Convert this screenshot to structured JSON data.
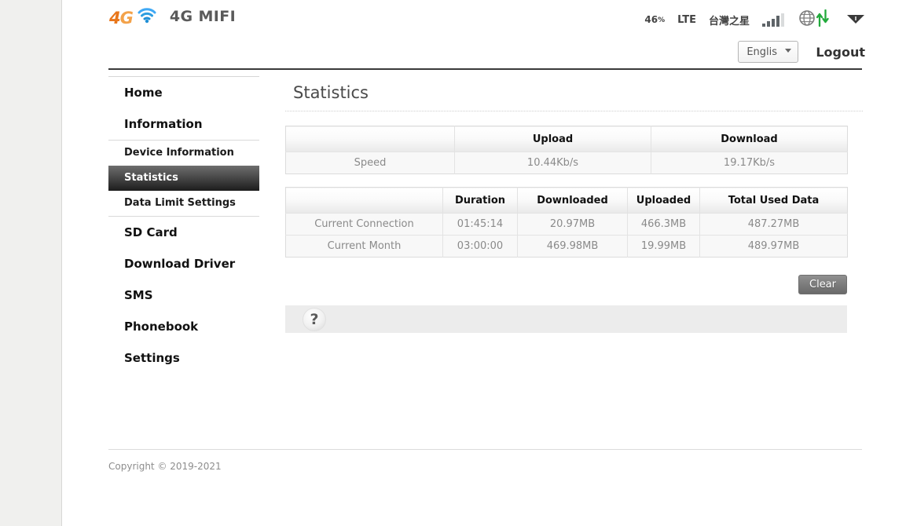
{
  "header": {
    "logo_text_4": "4",
    "logo_text_g": "G",
    "wifi_icon": "wifi-icon",
    "brand_title": "4G MIFI",
    "status": {
      "battery_percent": "46",
      "battery_unit": "%",
      "network_type": "LTE",
      "carrier": "台灣之星",
      "signal_icon": "signal-bars-icon",
      "signal_bars_active": 4,
      "signal_bars_total": 5,
      "globe_icon": "globe-icon",
      "transfer_icon": "upload-download-arrows-icon",
      "wifi_status_icon": "wifi-signal-icon"
    },
    "language": {
      "selected": "English",
      "options": [
        "English"
      ],
      "chevron_icon": "chevron-down-icon"
    },
    "logout_label": "Logout"
  },
  "sidebar": {
    "items": [
      {
        "label": "Home",
        "type": "top",
        "active": false
      },
      {
        "label": "Information",
        "type": "top",
        "active": false
      },
      {
        "label": "Device Information",
        "type": "sub",
        "active": false
      },
      {
        "label": "Statistics",
        "type": "sub",
        "active": true
      },
      {
        "label": "Data Limit Settings",
        "type": "sub",
        "active": false
      },
      {
        "label": "SD Card",
        "type": "top",
        "active": false
      },
      {
        "label": "Download Driver",
        "type": "top",
        "active": false
      },
      {
        "label": "SMS",
        "type": "top",
        "active": false
      },
      {
        "label": "Phonebook",
        "type": "top",
        "active": false
      },
      {
        "label": "Settings",
        "type": "top",
        "active": false
      }
    ]
  },
  "main": {
    "page_title": "Statistics",
    "speed_table": {
      "headers": [
        "",
        "Upload",
        "Download"
      ],
      "rows": [
        [
          "Speed",
          "10.44Kb/s",
          "19.17Kb/s"
        ]
      ]
    },
    "usage_table": {
      "headers": [
        "",
        "Duration",
        "Downloaded",
        "Uploaded",
        "Total Used Data"
      ],
      "rows": [
        [
          "Current Connection",
          "01:45:14",
          "20.97MB",
          "466.3MB",
          "487.27MB"
        ],
        [
          "Current Month",
          "03:00:00",
          "469.98MB",
          "19.99MB",
          "489.97MB"
        ]
      ]
    },
    "clear_button_label": "Clear",
    "help_icon_label": "?"
  },
  "footer": {
    "copyright": "Copyright © 2019-2021"
  },
  "colors": {
    "accent_orange": "#e8761b",
    "accent_blue": "#2e9ee0",
    "green_arrow": "#22aa3c",
    "active_nav_dark": "#1c1c1c"
  }
}
